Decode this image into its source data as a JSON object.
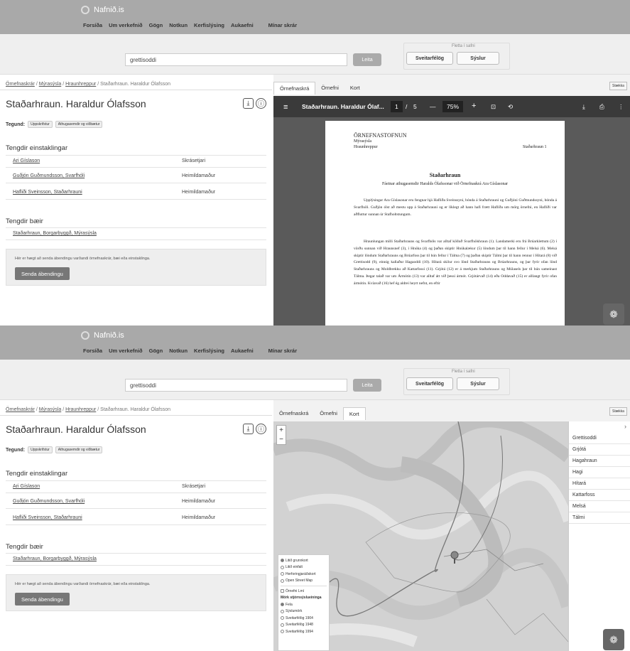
{
  "site": {
    "logo": "Nafnið.is"
  },
  "nav": [
    "Forsíða",
    "Um verkefnið",
    "Gögn",
    "Notkun",
    "Kerfislýsing",
    "Aukaefni"
  ],
  "nav_right": "Mínar skrár",
  "search": {
    "value": "grettisoddi",
    "button": "Leita"
  },
  "filter": {
    "title": "Fletta í safni",
    "btn1": "Sveitarfélög",
    "btn2": "Sýslur"
  },
  "breadcrumb": {
    "a": "Örnefnaskrár",
    "b": "Mýrasýsla",
    "c": "Hraunhreppur",
    "d": "Staðarhraun. Haraldur Ólafsson",
    "sep": "/"
  },
  "page": {
    "title": "Staðarhraun. Haraldur Ólafsson",
    "tegund_label": "Tegund:",
    "tag1": "Uppskrifstur",
    "tag2": "Athugasemdir og viðbætur"
  },
  "persons": {
    "heading": "Tengdir einstaklingar",
    "rows": [
      {
        "name": "Ari Gíslason",
        "role": "Skrásetjari"
      },
      {
        "name": "Guðjón Guðmundsson, Svarfhóli",
        "role": "Heimildamaður"
      },
      {
        "name": "Hafliði Sveinsson, Staðarhrauni",
        "role": "Heimildamaður"
      }
    ]
  },
  "farms": {
    "heading": "Tengdir bæir",
    "item": "Staðarhraun, Borgarbyggð, Mýrasýsla"
  },
  "tip": {
    "text": "Hér er hægt að senda ábendingu varðandi örnefnaskrár, bæi eða einstaklinga.",
    "button": "Senda ábendingu"
  },
  "tabs": [
    "Örnefnaskrá",
    "Örnefni",
    "Kort"
  ],
  "right_btn": "Stækka",
  "pdf": {
    "title": "Staðarhraun. Haraldur Ólaf...",
    "page": "1",
    "sep": "/",
    "total": "5",
    "zoom": "75%",
    "minus": "—",
    "plus": "+"
  },
  "doc": {
    "org": "ÖRNEFNASTOFNUN",
    "county": "Mýrasýsla",
    "district": "Hraunhreppur",
    "farm_right": "Staðarhraun 1",
    "heading": "Staðarhraun",
    "subheading": "Fáeinar athugasemdir Haralds Ólafssonar við Örnefnaskrá Ara Gíslasonar",
    "p1": "Upplýsingar Ara Gíslasonar eru fengnar hjá Hafliða Sveinssyni, bónda á Staðarhrauni og Guðjóni Guðmundssyni, bónda á Svarfhóli. Guðjón ólst að mestu upp á Staðarhrauni og er líklegt að hann hafi frætt Hafliða um mörg örnefni, en Hafliði var aðfluttur sunnan úr Stafholtstungum.",
    "p2": "Hraunlungan milli Staðarhrauns og Svarfhóls var alltaf kölluð Svarfhólshraun (1). Landamerki eru frá Brúarklettum (2) í vörðu sunnan við Hraunsnef (3), í Hnúka (4) og þaðan skiptir Hnúkalækur (5) löndum þar til hann fellur í Melsá (6). Melsá skiptir löndum Staðarhrauns og Brúarfoss þar til hún fellur í Tálma (7) og þaðan skiptir Tálmi þar til hann rennur í Hítará (8) við Grettisodd (9), einnig kallaður Hagaoddi (10). Hítará skilur svo lönd Staðarhrauns og Brúarhrauns, og þar fyrir ofan lönd Staðarhrauns og Moldbrekku að Kattarfossi (11). Grjótá (12) er á merkjum Staðarhrauns og Múlasels þar til hún sameinast Tálma. Þegar talað var um Ármótin (13) var alltaf átt við þessi ármót. Grjótárvað (14) eða Oddavað (15) er alllangt fyrir ofan ármótin. Kvíavað (16) hef ég aldrei heyrt nefnt, en eftir"
  },
  "map_layers": {
    "base": [
      "Litið grunnkort",
      "Litið einfalt",
      "Herforingjaráðskort",
      "Open Street Map"
    ],
    "base_selected": 0,
    "overlay": "Örnefni Lmí",
    "section": "Mörk stjórnsýslueininga",
    "admin": [
      "Fela",
      "Sýslumörk",
      "Sveitarfélög 1904",
      "Sveitarfélög 1948",
      "Sveitarfélög 1994"
    ],
    "admin_selected": 0
  },
  "place_names": [
    "Grettisoddi",
    "Grjótá",
    "Hagahraun",
    "Hagi",
    "Hítará",
    "Kattarfoss",
    "Melsá",
    "Tálmi"
  ],
  "colors": {
    "topbar": "#a9a9a9",
    "pdfbar": "#3a3a3a",
    "map": "#d4d4d4"
  }
}
